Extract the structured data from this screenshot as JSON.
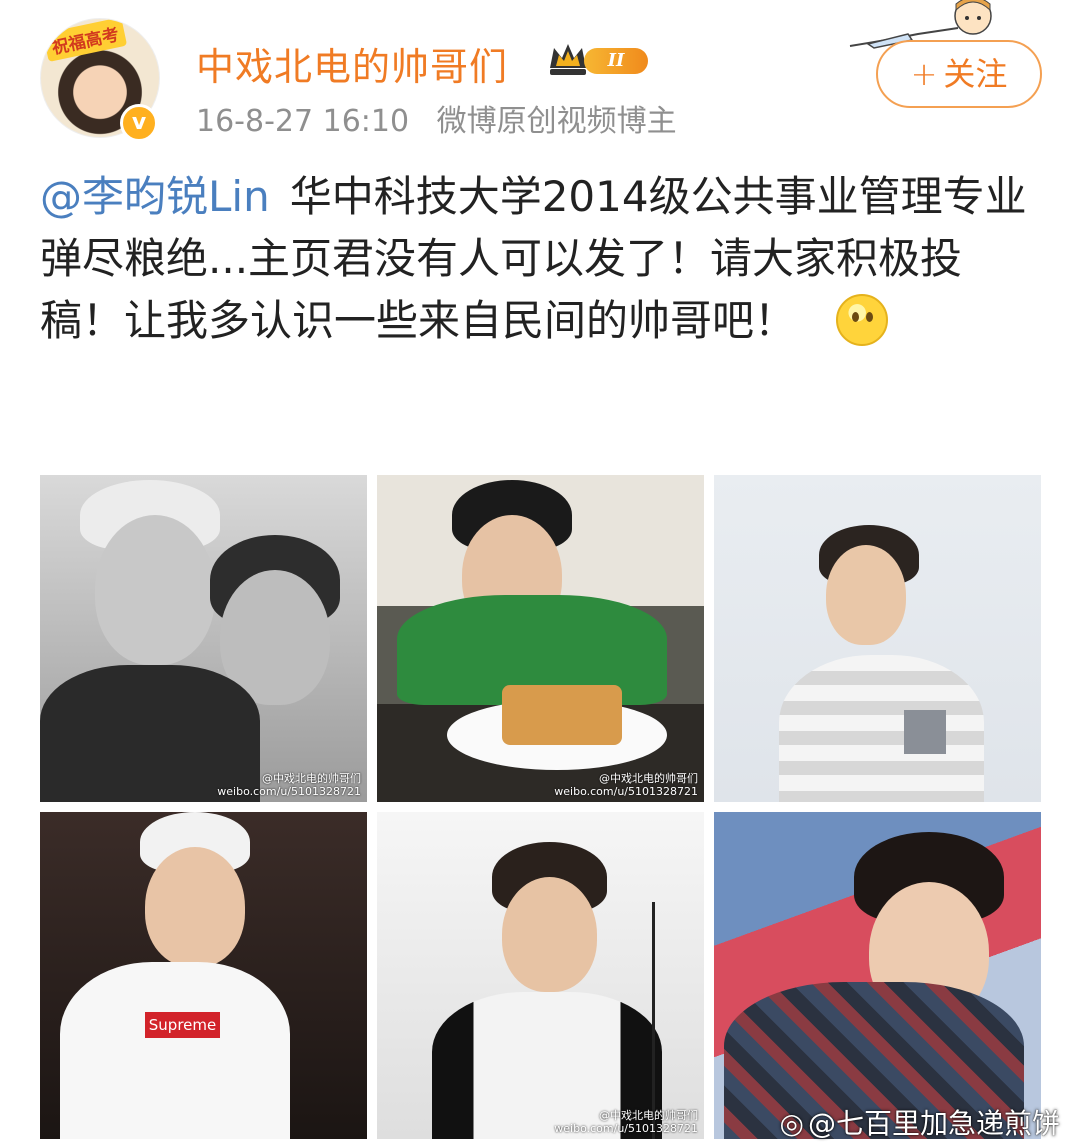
{
  "header": {
    "avatar_ribbon": "祝福高考",
    "verified": "v",
    "username": "中戏北电的帅哥们",
    "level": "II",
    "date": "16-8-27 16:10",
    "source": "微博原创视频博主",
    "follow_plus": "+",
    "follow_label": "关注"
  },
  "post": {
    "mention": "@李昀锐Lin",
    "text": "华中科技大学2014级公共事业管理专业 弹尽粮绝...主页君没有人可以发了！请大家积极投稿！让我多认识一些来自民间的帅哥吧！",
    "emoji": "thinking-emoji"
  },
  "photos": [
    {
      "watermark": "@中戏北电的帅哥们\nweibo.com/u/5101328721"
    },
    {
      "watermark": "@中戏北电的帅哥们\nweibo.com/u/5101328721"
    },
    {
      "watermark": ""
    },
    {
      "watermark": ""
    },
    {
      "watermark": "@中戏北电的帅哥们\nweibo.com/u/5101328721"
    },
    {
      "watermark": ""
    }
  ],
  "footer_watermark": "@七百里加急递煎饼"
}
